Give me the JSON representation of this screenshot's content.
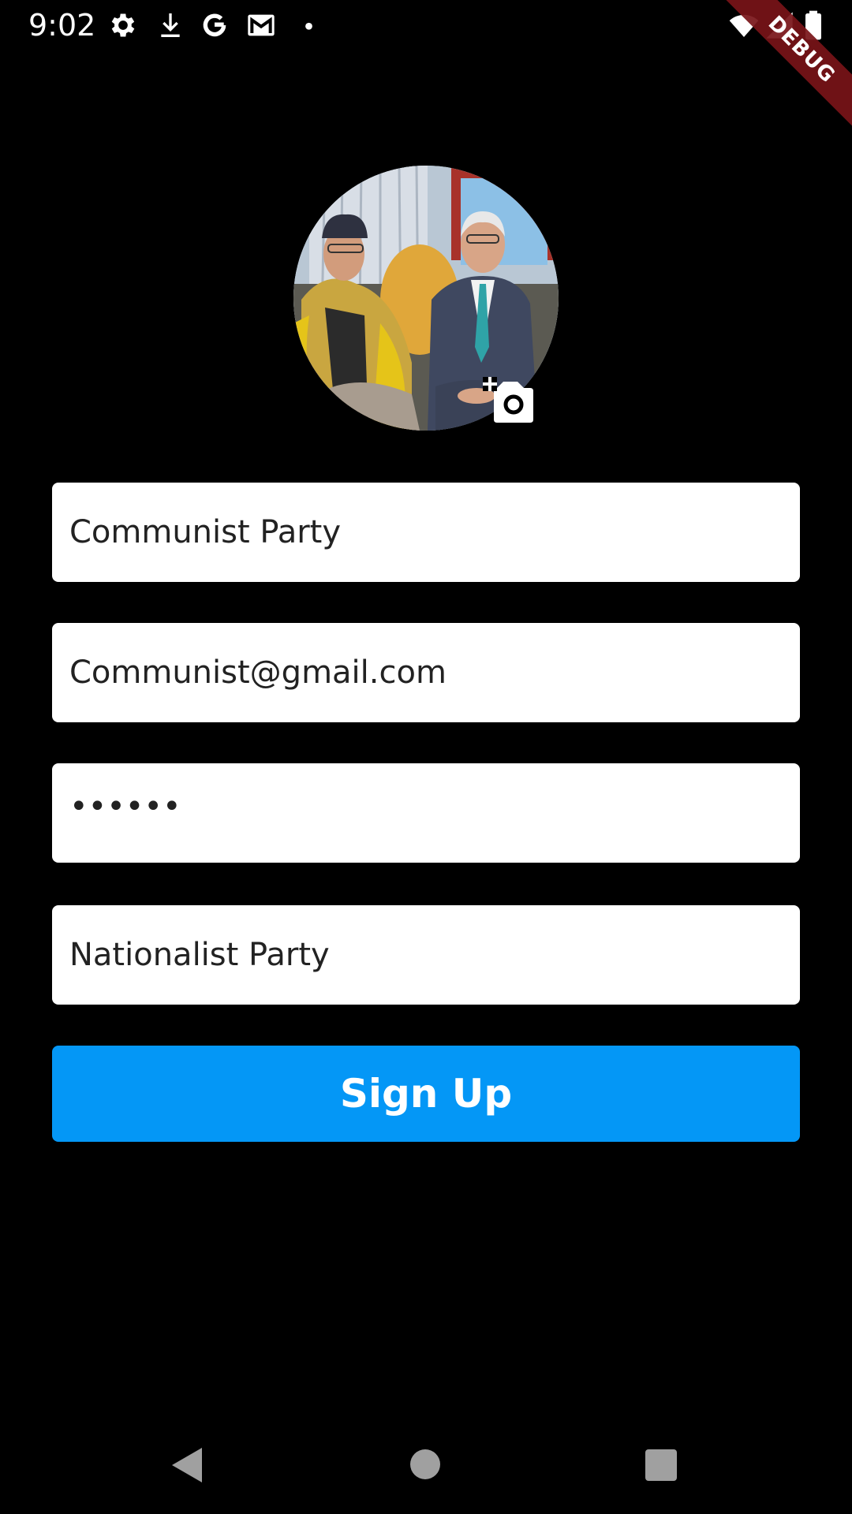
{
  "status_bar": {
    "time": "9:02",
    "icons": [
      "gear-icon",
      "download-icon",
      "google-icon",
      "gmail-icon",
      "dot-icon",
      "wifi-icon",
      "signal-icon",
      "battery-icon"
    ]
  },
  "debug_banner": {
    "label": "DEBUG",
    "color": "#78141a"
  },
  "profile": {
    "avatar_alt": "profile photo",
    "camera_icon": "add-photo-icon"
  },
  "form": {
    "name_value": "Communist Party",
    "email_value": "Communist@gmail.com",
    "password_value": "••••••",
    "party_value": "Nationalist Party",
    "submit_label": "Sign Up",
    "submit_color": "#0497f6"
  },
  "nav_bar": {
    "icons": [
      "back-icon",
      "home-icon",
      "recents-icon"
    ]
  }
}
